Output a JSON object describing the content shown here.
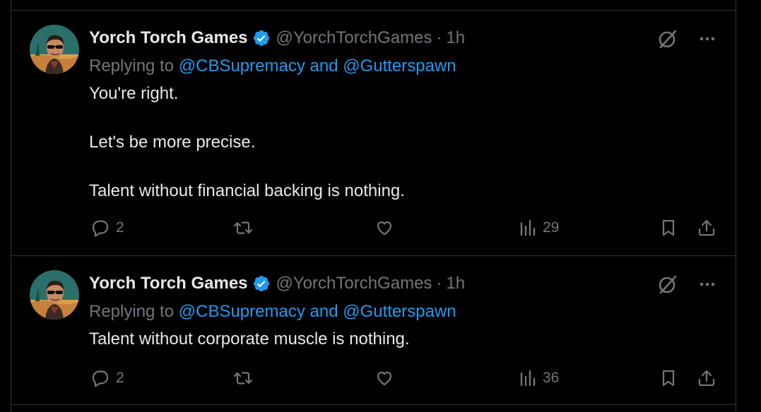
{
  "tweets": [
    {
      "display_name": "Yorch Torch Games",
      "handle": "@YorchTorchGames",
      "separator": "·",
      "time": "1h",
      "replying_prefix": "Replying to",
      "replying_mentions": "@CBSupremacy and @Gutterspawn",
      "lines": [
        "You're right.",
        "Let's be more precise.",
        "Talent without financial backing is nothing."
      ],
      "replies": "2",
      "views": "29",
      "avatar_icon": "avatar-man-sunglasses",
      "verified_icon": "verified-badge-icon"
    },
    {
      "display_name": "Yorch Torch Games",
      "handle": "@YorchTorchGames",
      "separator": "·",
      "time": "1h",
      "replying_prefix": "Replying to",
      "replying_mentions": "@CBSupremacy and @Gutterspawn",
      "lines": [
        "Talent without corporate muscle is nothing."
      ],
      "replies": "2",
      "views": "36",
      "avatar_icon": "avatar-man-sunglasses",
      "verified_icon": "verified-badge-icon"
    }
  ],
  "colors": {
    "background": "#000000",
    "text": "#e7e9ea",
    "muted": "#71767b",
    "accent": "#1d9bf0",
    "border": "#2f3336"
  }
}
